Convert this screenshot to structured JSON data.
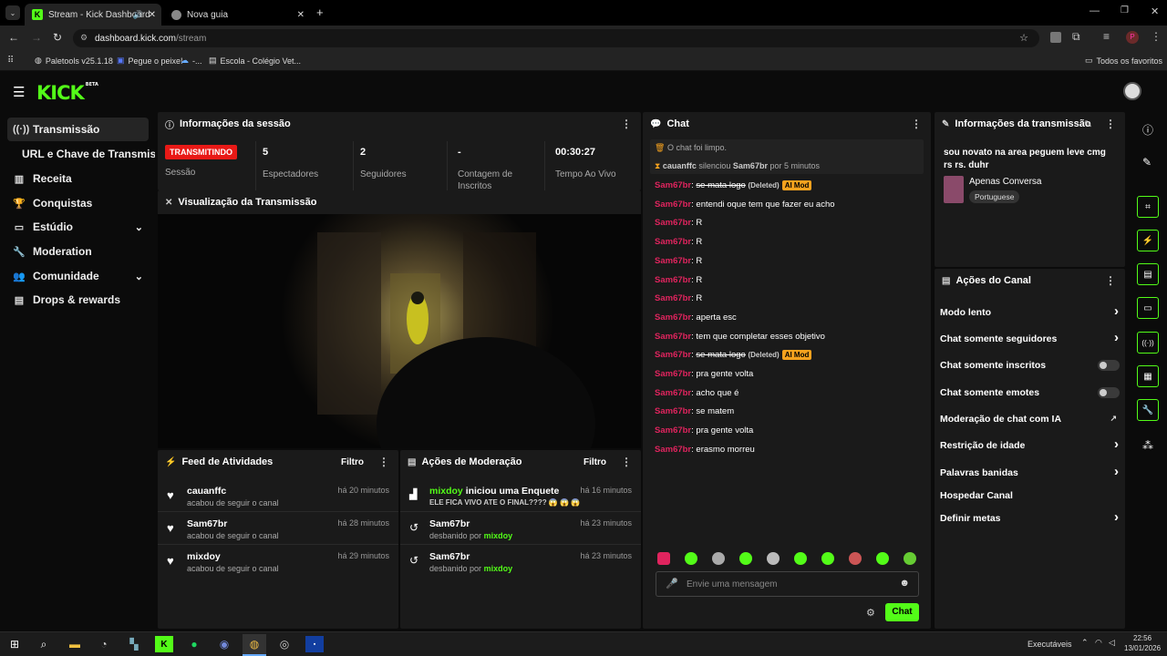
{
  "browser": {
    "tabs": [
      {
        "title": "Stream - Kick Dashboard",
        "active": true,
        "icon": "kick-favicon"
      },
      {
        "title": "Nova guia",
        "active": false,
        "icon": "chrome-icon"
      }
    ],
    "url_domain": "dashboard.kick.com",
    "url_path": "/stream",
    "profile_initial": "P",
    "bookmarks": [
      "Paletools v25.1.18",
      "Pegue o peixe!",
      "-...",
      "Escola - Colégio Vet..."
    ],
    "all_bookmarks": "Todos os favoritos"
  },
  "app": {
    "logo": "KICK",
    "logo_badge": "BETA",
    "accent": "#53fc18"
  },
  "sidebar": {
    "items": [
      {
        "label": "Transmissão",
        "icon": "broadcast-icon",
        "active": true
      },
      {
        "label": "URL e Chave de Transmissão",
        "icon": "",
        "active": false
      },
      {
        "label": "Receita",
        "icon": "revenue-icon",
        "active": false
      },
      {
        "label": "Conquistas",
        "icon": "trophy-icon",
        "active": false
      },
      {
        "label": "Estúdio",
        "icon": "studio-icon",
        "active": false,
        "expandable": true
      },
      {
        "label": "Moderation",
        "icon": "wrench-icon",
        "active": false
      },
      {
        "label": "Comunidade",
        "icon": "community-icon",
        "active": false,
        "expandable": true
      },
      {
        "label": "Drops & rewards",
        "icon": "drops-icon",
        "active": false
      }
    ]
  },
  "session": {
    "title": "Informações da sessão",
    "live_badge": "TRANSMITINDO",
    "session_label": "Sessão",
    "stats": [
      {
        "value": "5",
        "label": "Espectadores"
      },
      {
        "value": "2",
        "label": "Seguidores"
      },
      {
        "value": "-",
        "label": "Contagem de Inscritos"
      },
      {
        "value": "00:30:27",
        "label": "Tempo Ao Vivo"
      }
    ]
  },
  "preview": {
    "title": "Visualização da Transmissão"
  },
  "activity": {
    "title": "Feed de Atividades",
    "filter": "Filtro",
    "items": [
      {
        "name": "cauanffc",
        "text": "acabou de seguir o canal",
        "time": "há 20 minutos"
      },
      {
        "name": "Sam67br",
        "text": "acabou de seguir o canal",
        "time": "há 28 minutos"
      },
      {
        "name": "mixdoy",
        "text": "acabou de seguir o canal",
        "time": "há 29 minutos"
      }
    ]
  },
  "moderation": {
    "title": "Ações de Moderação",
    "filter": "Filtro",
    "items": [
      {
        "name": "mixdoy",
        "action": "iniciou uma Enquete",
        "text": "ELE FICA VIVO ATE O FINAL???? 😱 😱 😱",
        "time": "há 16 minutos",
        "icon": "poll-icon"
      },
      {
        "name": "Sam67br",
        "action": "",
        "text": "desbanido por",
        "by": "mixdoy",
        "time": "há 23 minutos",
        "icon": "unban-icon"
      },
      {
        "name": "Sam67br",
        "action": "",
        "text": "desbanido por",
        "by": "mixdoy",
        "time": "há 23 minutos",
        "icon": "unban-icon"
      }
    ]
  },
  "chat": {
    "title": "Chat",
    "system": [
      {
        "text": "O chat foi limpo."
      },
      {
        "user": "cauanffc",
        "mid": "silenciou",
        "target": "Sam67br",
        "tail": "por 5 minutos"
      }
    ],
    "messages": [
      {
        "user": "Sam67br",
        "text": "se mata logo",
        "deleted": true,
        "deleted_label": "(Deleted)",
        "badge": "AI Mod"
      },
      {
        "user": "Sam67br",
        "text": "entendi oque tem que fazer eu acho"
      },
      {
        "user": "Sam67br",
        "text": "R"
      },
      {
        "user": "Sam67br",
        "text": "R"
      },
      {
        "user": "Sam67br",
        "text": "R"
      },
      {
        "user": "Sam67br",
        "text": "R"
      },
      {
        "user": "Sam67br",
        "text": "R"
      },
      {
        "user": "Sam67br",
        "text": "aperta esc"
      },
      {
        "user": "Sam67br",
        "text": "tem que completar esses objetivo"
      },
      {
        "user": "Sam67br",
        "text": "se mata logo",
        "deleted": true,
        "deleted_label": "(Deleted)",
        "badge": "AI Mod"
      },
      {
        "user": "Sam67br",
        "text": "pra gente volta"
      },
      {
        "user": "Sam67br",
        "text": "acho que é"
      },
      {
        "user": "Sam67br",
        "text": "se matem"
      },
      {
        "user": "Sam67br",
        "text": "pra gente volta"
      },
      {
        "user": "Sam67br",
        "text": "erasmo morreu"
      }
    ],
    "input_placeholder": "Envie uma mensagem",
    "send_label": "Chat"
  },
  "stream_info": {
    "title": "Informações da transmissão",
    "stream_title": "sou novato na area peguem leve cmg rs rs. duhr",
    "category": "Apenas Conversa",
    "language": "Portuguese"
  },
  "channel_actions": {
    "title": "Ações do Canal",
    "items": [
      {
        "label": "Modo lento",
        "control": "chevron"
      },
      {
        "label": "Chat somente seguidores",
        "control": "chevron"
      },
      {
        "label": "Chat somente inscritos",
        "control": "toggle",
        "on": false
      },
      {
        "label": "Chat somente emotes",
        "control": "toggle",
        "on": false
      },
      {
        "label": "Moderação de chat com IA",
        "control": "external"
      },
      {
        "label": "Restrição de idade",
        "control": "chevron"
      },
      {
        "label": "Palavras banidas",
        "control": "chevron"
      },
      {
        "label": "Hospedar Canal",
        "control": "none"
      },
      {
        "label": "Definir metas",
        "control": "chevron"
      }
    ]
  },
  "taskbar": {
    "tray_label": "Executáveis",
    "time": "22:56",
    "date": "13/01/2026"
  }
}
